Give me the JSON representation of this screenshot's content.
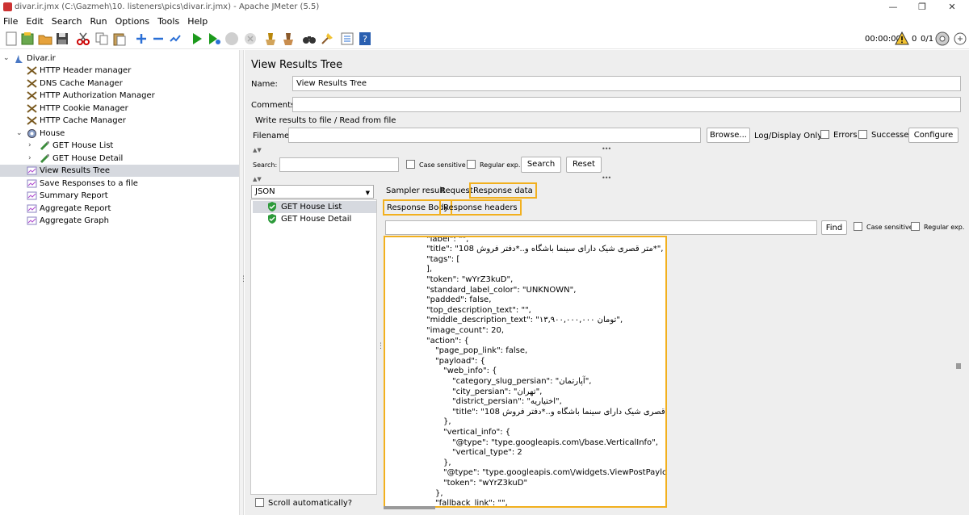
{
  "window": {
    "title": "divar.ir.jmx (C:\\Gazmeh\\10. listeners\\pics\\divar.ir.jmx) - Apache JMeter (5.5)",
    "minimize": "—",
    "maximize": "❐",
    "close": "✕"
  },
  "menu": [
    "File",
    "Edit",
    "Search",
    "Run",
    "Options",
    "Tools",
    "Help"
  ],
  "toolbar": {
    "icons": [
      "new-icon",
      "templates-icon",
      "open-icon",
      "save-icon",
      "cut-icon",
      "copy-icon",
      "paste-icon",
      "expand-icon",
      "collapse-icon",
      "toggle-icon",
      "start-icon",
      "start-no-pauses-icon",
      "stop-icon",
      "shutdown-icon",
      "clear-icon",
      "clear-all-icon",
      "search-icon",
      "reset-search-icon",
      "function-helper-icon",
      "help-icon"
    ],
    "timer": "00:00:00",
    "warning_count": "0",
    "threads": "0/1"
  },
  "tree": {
    "items": [
      {
        "label": "Divar.ir",
        "icon": "test-plan-icon"
      },
      {
        "label": "HTTP Header manager",
        "icon": "config-scissors-icon"
      },
      {
        "label": "DNS Cache Manager",
        "icon": "config-scissors-icon"
      },
      {
        "label": "HTTP Authorization Manager",
        "icon": "config-scissors-icon"
      },
      {
        "label": "HTTP Cookie Manager",
        "icon": "config-scissors-icon"
      },
      {
        "label": "HTTP Cache Manager",
        "icon": "config-scissors-icon"
      },
      {
        "label": "House",
        "icon": "thread-group-gear-icon"
      },
      {
        "label": "GET House List",
        "icon": "sampler-pipette-icon"
      },
      {
        "label": "GET House Detail",
        "icon": "sampler-pipette-icon"
      },
      {
        "label": "View Results Tree",
        "icon": "listener-chart-icon"
      },
      {
        "label": "Save Responses to a file",
        "icon": "listener-chart-icon"
      },
      {
        "label": "Summary Report",
        "icon": "listener-chart-icon"
      },
      {
        "label": "Aggregate Report",
        "icon": "listener-chart-icon"
      },
      {
        "label": "Aggregate Graph",
        "icon": "listener-chart-icon"
      }
    ]
  },
  "panel": {
    "title": "View Results Tree",
    "name_label": "Name:",
    "name_value": "View Results Tree",
    "comments_label": "Comments:",
    "comments_value": "",
    "write_results_label": "Write results to file / Read from file",
    "filename_label": "Filename",
    "filename_value": "",
    "browse_button": "Browse...",
    "log_display_label": "Log/Display Only:",
    "errors_label": "Errors",
    "successes_label": "Successes",
    "configure_button": "Configure",
    "search_label": "Search:",
    "search_value": "",
    "case_sensitive_label": "Case sensitive",
    "regular_exp_label": "Regular exp.",
    "search_button": "Search",
    "reset_button": "Reset",
    "renderer_value": "JSON",
    "results": [
      "GET House List",
      "GET House Detail"
    ],
    "scroll_auto_label": "Scroll automatically?",
    "tabs": [
      "Sampler result",
      "Request",
      "Response data"
    ],
    "subtabs": [
      "Response Body",
      "Response headers"
    ],
    "find_value": "",
    "find_button": "Find",
    "find_case_label": "Case sensitive",
    "find_regex_label": "Regular exp.",
    "response_lines": [
      "\"label\": \"\",",
      "\"title\": \"متر قصری شیک دارای سینما باشگاه و..*دفتر فروش 108*\",",
      "\"tags\": [",
      "],",
      "\"token\": \"wYrZ3kuD\",",
      "\"standard_label_color\": \"UNKNOWN\",",
      "\"padded\": false,",
      "\"top_description_text\": \"\",",
      "\"middle_description_text\": \"۱۳,۹۰۰,۰۰۰,۰۰۰ تومان\",",
      "\"image_count\": 20,",
      "\"action\": {",
      "\"page_pop_link\": false,",
      "\"payload\": {",
      "\"web_info\": {",
      "\"category_slug_persian\": \"آپارتمان\",",
      "\"city_persian\": \"تهران\",",
      "\"district_persian\": \"اختیاریه\",",
      "\"title\": \"متر قصری شیک دارای سینما باشگاه و..*دفتر فروش 108*\"",
      "},",
      "\"vertical_info\": {",
      "\"@type\": \"type.googleapis.com\\/base.VerticalInfo\",",
      "\"vertical_type\": 2",
      "},",
      "\"@type\": \"type.googleapis.com\\/widgets.ViewPostPayload\",",
      "\"token\": \"wYrZ3kuD\"",
      "},",
      "\"fallback_link\": \"\","
    ]
  }
}
